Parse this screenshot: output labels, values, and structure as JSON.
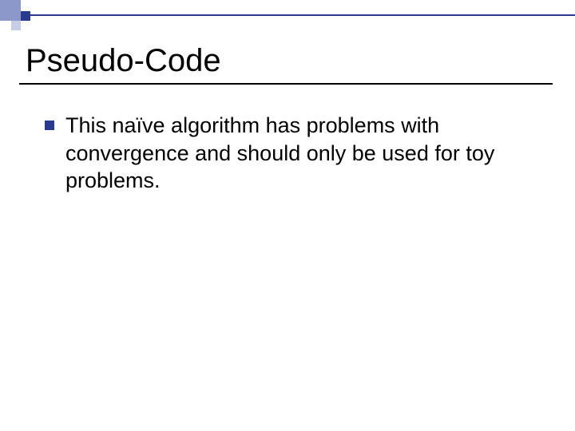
{
  "slide": {
    "title": "Pseudo-Code",
    "bullets": [
      {
        "text": "This naïve algorithm has problems with convergence and should only be used for toy problems."
      }
    ]
  },
  "colors": {
    "accent_dark": "#2a3b8f",
    "accent_mid": "#8b98c9",
    "accent_light": "#c6cde6"
  }
}
